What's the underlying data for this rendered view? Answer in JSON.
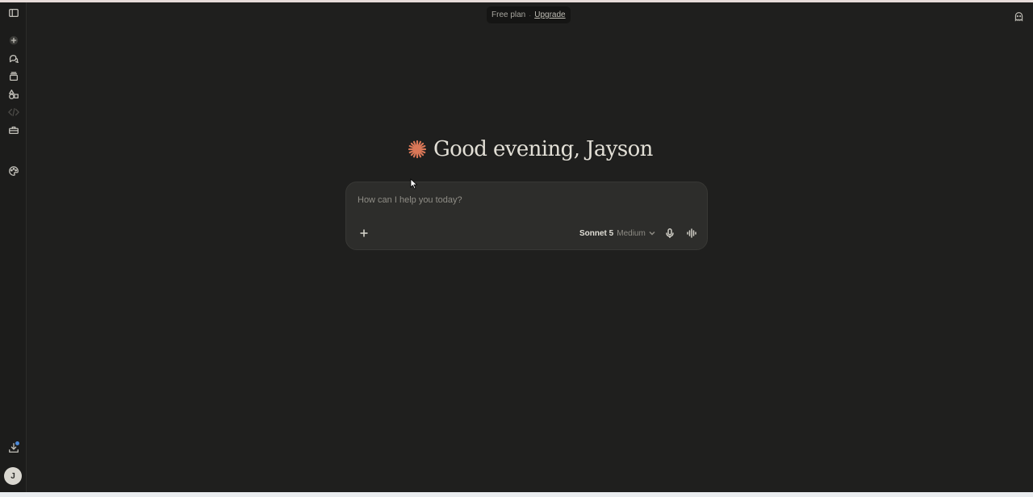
{
  "sidebar": {
    "items": [
      {
        "name": "toggle-sidebar",
        "icon": "sidebar-toggle-icon"
      },
      {
        "name": "new-chat",
        "icon": "plus-icon"
      },
      {
        "name": "chats",
        "icon": "chat-bubbles-icon"
      },
      {
        "name": "projects",
        "icon": "stack-icon"
      },
      {
        "name": "artifacts",
        "icon": "shapes-icon"
      },
      {
        "name": "code",
        "icon": "code-icon"
      },
      {
        "name": "tools",
        "icon": "toolbox-icon"
      },
      {
        "name": "customize",
        "icon": "palette-icon"
      },
      {
        "name": "downloads",
        "icon": "download-icon"
      }
    ],
    "avatar_initial": "J"
  },
  "plan": {
    "label": "Free plan",
    "separator": "·",
    "upgrade": "Upgrade"
  },
  "greeting": {
    "text": "Good evening, Jayson",
    "logo_icon": "spark-logo-icon",
    "accent_color": "#d97757"
  },
  "composer": {
    "placeholder": "How can I help you today?",
    "model": "Sonnet 5",
    "effort": "Medium",
    "add_icon": "plus-icon",
    "mic_icon": "microphone-icon",
    "voice_icon": "voice-waveform-icon"
  },
  "colors": {
    "background": "#1f1f1e",
    "composer": "#2d2d2b",
    "text": "#e2dfd6",
    "notification_dot": "#4d8ad8"
  }
}
